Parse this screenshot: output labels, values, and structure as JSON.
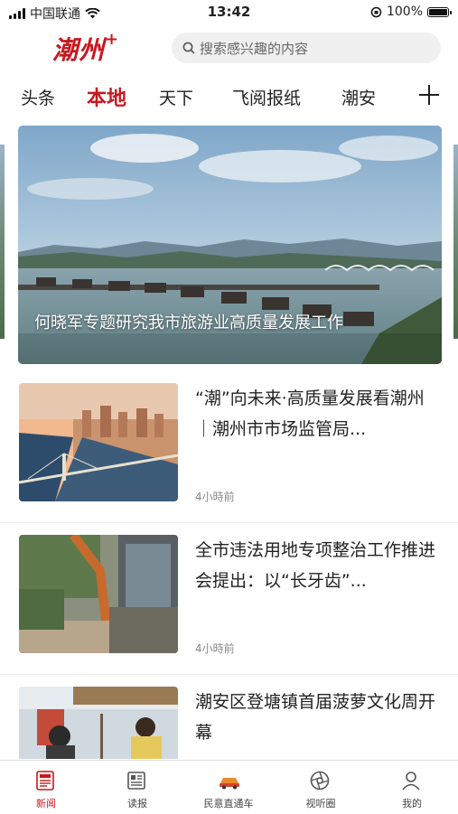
{
  "status_bar": {
    "carrier": "中国联通",
    "time": "13:42",
    "battery": "100%"
  },
  "header": {
    "logo_text": "潮州",
    "logo_plus": "+",
    "search_placeholder": "搜索感兴趣的内容"
  },
  "tabs": [
    {
      "label": "头条"
    },
    {
      "label": "本地",
      "active": true
    },
    {
      "label": "天下"
    },
    {
      "label": "飞阅报纸"
    },
    {
      "label": "潮安"
    }
  ],
  "hero": {
    "caption": "何晓军专题研究我市旅游业高质量发展工作"
  },
  "news": [
    {
      "title": "“潮”向未来·高质量发展看潮州｜潮州市市场监管局...",
      "time": "4小時前"
    },
    {
      "title": "全市违法用地专项整治工作推进会提出：以“长牙齿”...",
      "time": "4小時前"
    },
    {
      "title": "潮安区登塘镇首届菠萝文化周开幕",
      "time": ""
    }
  ],
  "bottom_nav": [
    {
      "label": "新闻",
      "icon": "newspaper-icon",
      "active": true
    },
    {
      "label": "读报",
      "icon": "paper-icon"
    },
    {
      "label": "民意直通车",
      "icon": "car-icon"
    },
    {
      "label": "视听圈",
      "icon": "aperture-icon"
    },
    {
      "label": "我的",
      "icon": "user-icon"
    }
  ],
  "colors": {
    "accent": "#c8171e",
    "background": "#ffffff"
  }
}
